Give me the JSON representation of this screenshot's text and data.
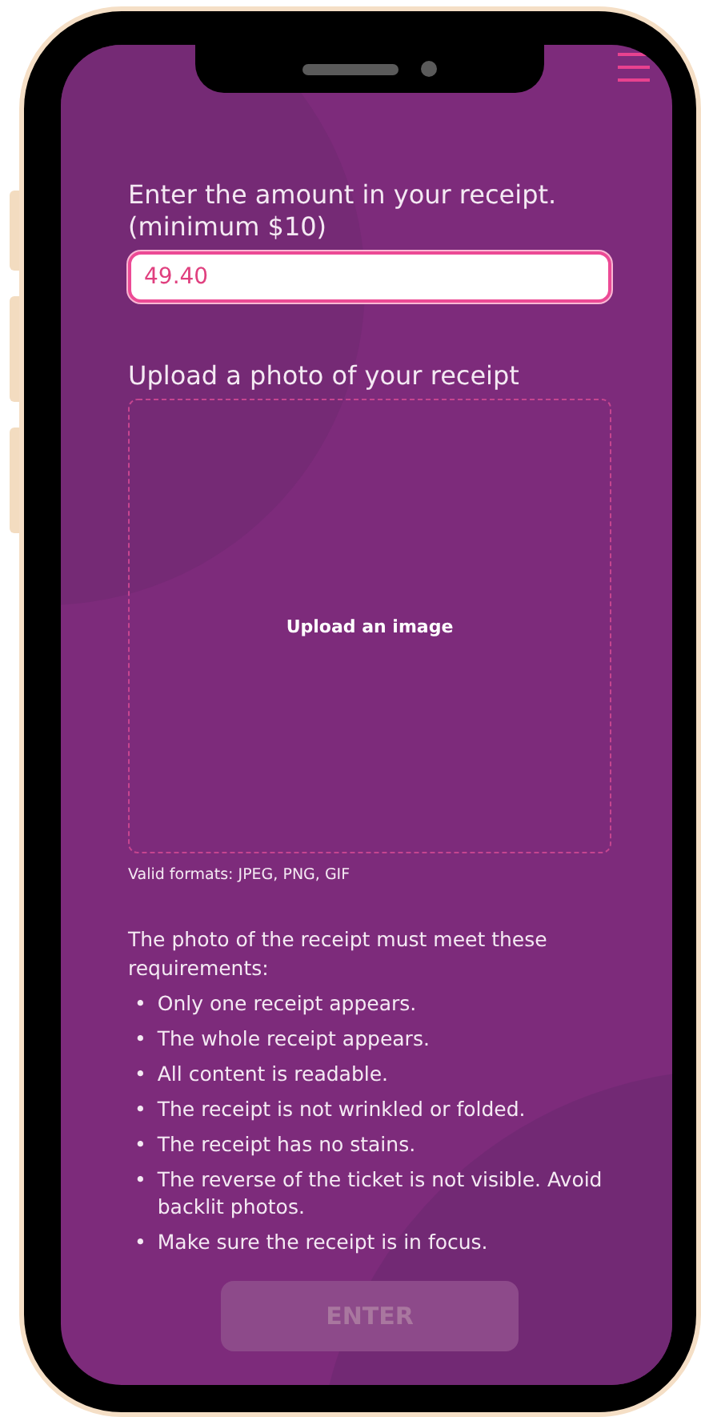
{
  "amount": {
    "label": "Enter the amount in your receipt. (minimum $10)",
    "value": "49.40"
  },
  "upload": {
    "label": "Upload a photo of your receipt",
    "prompt": "Upload an image",
    "note": "Valid formats: JPEG, PNG, GIF"
  },
  "requirements": {
    "intro": "The photo of the receipt must meet these requirements:",
    "items": [
      {
        "bullet": "•",
        "text": "Only one receipt appears."
      },
      {
        "bullet": "•",
        "text": "The whole receipt appears."
      },
      {
        "bullet": "•",
        "text": "All content is readable."
      },
      {
        "bullet": "•",
        "text": "The receipt is not wrinkled or folded."
      },
      {
        "bullet": "•",
        "text": "The receipt has no stains."
      },
      {
        "bullet": "•",
        "text": "The reverse of the ticket is not visible. Avoid backlit photos."
      },
      {
        "bullet": "•",
        "text": "Make sure the receipt is in focus."
      }
    ]
  },
  "submit": {
    "label": "ENTER",
    "disabled": true
  }
}
